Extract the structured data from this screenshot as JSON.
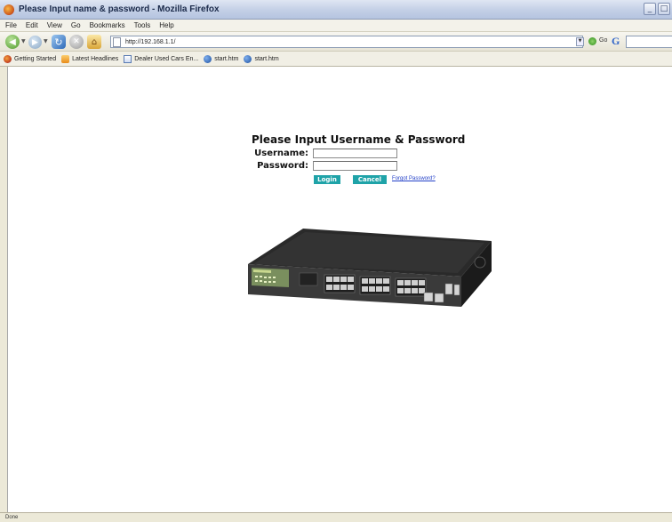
{
  "window": {
    "title": "Please Input name & password - Mozilla Firefox",
    "controls": [
      "_",
      "□"
    ]
  },
  "menu": {
    "items": [
      "File",
      "Edit",
      "View",
      "Go",
      "Bookmarks",
      "Tools",
      "Help"
    ]
  },
  "navigation": {
    "back_icon": "back-arrow-icon",
    "forward_icon": "forward-arrow-icon",
    "reload_icon": "reload-icon",
    "stop_icon": "stop-icon",
    "home_icon": "home-icon",
    "url": "http://192.168.1.1/",
    "go_label": "Go",
    "search_engine_icon": "google-search-icon"
  },
  "bookmarks": {
    "items": [
      {
        "label": "Getting Started",
        "icon": "firefox-icon"
      },
      {
        "label": "Latest Headlines",
        "icon": "rss-icon"
      },
      {
        "label": "Dealer Used Cars En...",
        "icon": "page-icon"
      },
      {
        "label": "start.htm",
        "icon": "globe-icon"
      },
      {
        "label": "start.htm",
        "icon": "globe-icon"
      }
    ]
  },
  "login": {
    "title": "Please Input Username & Password",
    "username_label": "Username:",
    "password_label": "Password:",
    "username_value": "",
    "password_value": "",
    "login_button": "Login",
    "cancel_button": "Cancel",
    "forgot_link": "Forgot Password?"
  },
  "status": {
    "text": "Done"
  }
}
